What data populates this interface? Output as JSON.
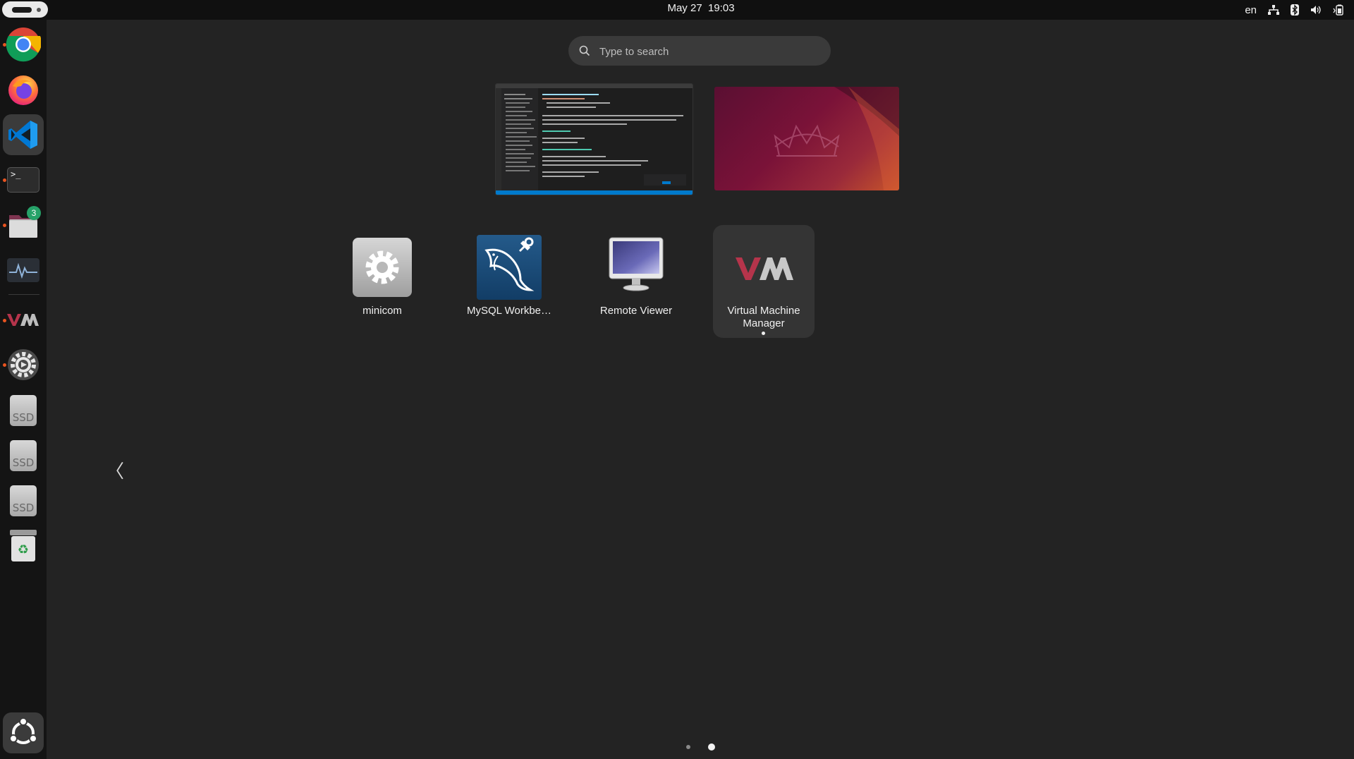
{
  "topbar": {
    "clock": "May 27  19:03",
    "language": "en",
    "tray_icons": [
      "network-icon",
      "bluetooth-icon",
      "volume-icon",
      "battery-icon"
    ]
  },
  "dock": {
    "items": [
      {
        "name": "chrome-icon",
        "running": true
      },
      {
        "name": "firefox-icon",
        "running": false
      },
      {
        "name": "vscode-icon",
        "running": false,
        "active": true
      },
      {
        "name": "terminal-icon",
        "running": true,
        "label": ">_"
      },
      {
        "name": "files-icon",
        "running": true,
        "badge": "3"
      },
      {
        "name": "system-monitor-icon",
        "running": false
      },
      {
        "name": "virt-manager-icon",
        "running": true
      },
      {
        "name": "settings-icon",
        "running": true
      },
      {
        "name": "ssd-drive-icon",
        "label": "SSD"
      },
      {
        "name": "ssd-drive-icon",
        "label": "SSD"
      },
      {
        "name": "ssd-drive-icon",
        "label": "SSD"
      },
      {
        "name": "trash-icon"
      },
      {
        "name": "show-apps-icon"
      }
    ]
  },
  "search": {
    "placeholder": "Type to search"
  },
  "apps": [
    {
      "label": "minicom",
      "icon": "gear-icon"
    },
    {
      "label": "MySQL Workbe…",
      "icon": "mysql-dolphin-icon"
    },
    {
      "label": "Remote Viewer",
      "icon": "monitor-icon"
    },
    {
      "label": "Virtual Machine\nManager",
      "icon": "virt-manager-icon",
      "highlighted": true,
      "running": true
    }
  ],
  "pagination": {
    "pages": 2,
    "current": 2
  },
  "colors": {
    "accent": "#e95420",
    "badge": "#26a269",
    "background": "#232323"
  }
}
